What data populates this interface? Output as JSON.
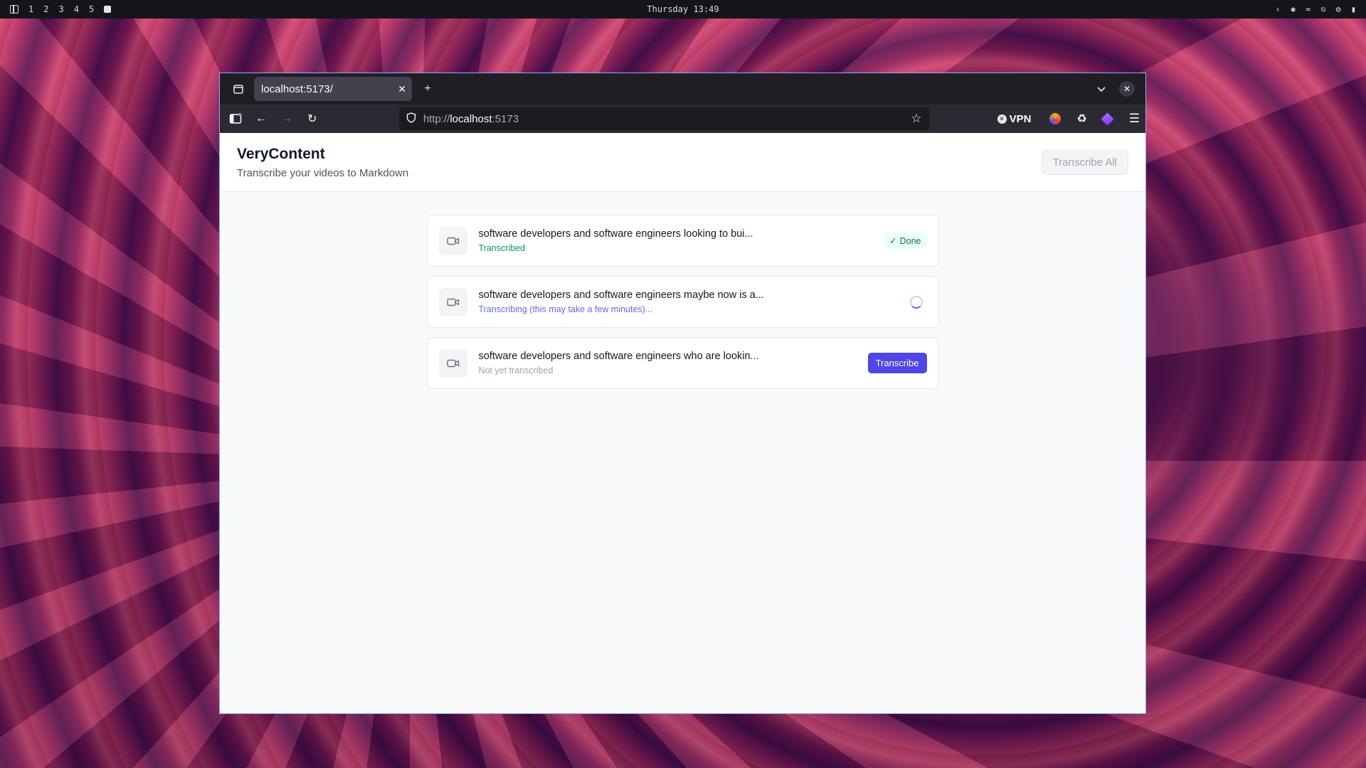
{
  "system_bar": {
    "workspaces": [
      "1",
      "2",
      "3",
      "4",
      "5"
    ],
    "clock": "Thursday 13:49",
    "tray_icons": [
      "chevron-left-icon",
      "bluetooth-icon",
      "wifi-icon",
      "headphones-icon",
      "settings-icon",
      "battery-icon"
    ]
  },
  "browser": {
    "tab": {
      "title": "localhost:5173/"
    },
    "url": {
      "scheme": "http://",
      "host": "localhost",
      "port": ":5173"
    },
    "vpn_label": "VPN",
    "accent_color": "#8fa8ff"
  },
  "app": {
    "title": "VeryContent",
    "subtitle": "Transcribe your videos to Markdown",
    "transcribe_all_label": "Transcribe All"
  },
  "videos": [
    {
      "title": "software developers and software engineers looking to bui...",
      "status": "Transcribed",
      "state": "done",
      "badge": "Done"
    },
    {
      "title": "software developers and software engineers maybe now is a...",
      "status": "Transcribing (this may take a few minutes)...",
      "state": "transcribing"
    },
    {
      "title": "software developers and software engineers who are lookin...",
      "status": "Not yet transcribed",
      "state": "idle",
      "action_label": "Transcribe"
    }
  ],
  "colors": {
    "primary": "#4f46e5",
    "success": "#059669",
    "progress": "#6366f1",
    "muted": "#9ca3af"
  }
}
